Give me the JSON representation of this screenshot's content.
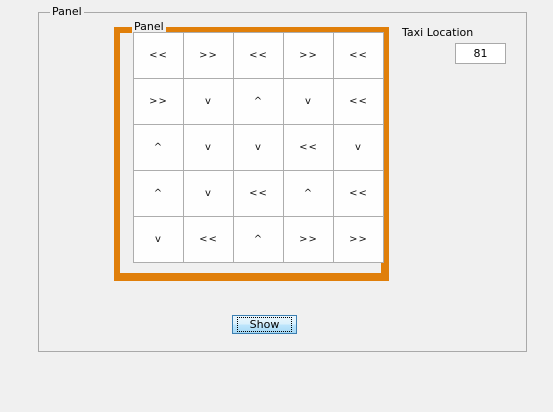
{
  "outer_panel": {
    "title": "Panel"
  },
  "grid_panel": {
    "title": "Panel",
    "border_color": "#e07f0a",
    "cells": [
      [
        "<<",
        ">>",
        "<<",
        ">>",
        "<<"
      ],
      [
        ">>",
        "v",
        "^",
        "v",
        "<<"
      ],
      [
        "^",
        "v",
        "v",
        "<<",
        "v"
      ],
      [
        "^",
        "v",
        "<<",
        "^",
        "<<"
      ],
      [
        "v",
        "<<",
        "^",
        ">>",
        ">>"
      ]
    ]
  },
  "taxi": {
    "label": "Taxi Location",
    "value": "81"
  },
  "show_button": {
    "label": "Show"
  }
}
